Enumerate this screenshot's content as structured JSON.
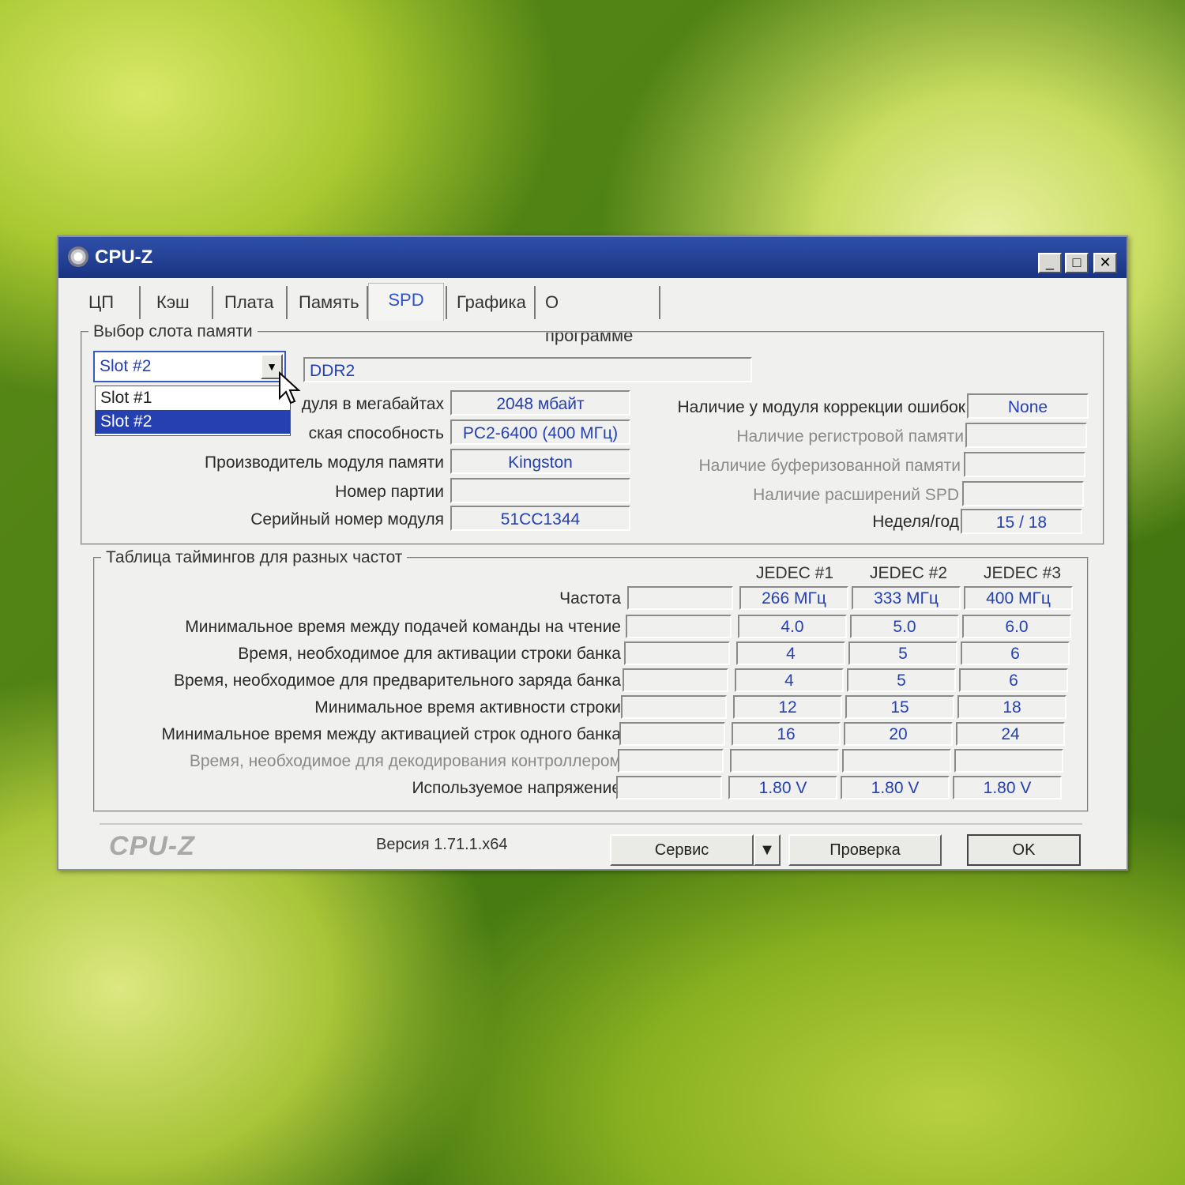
{
  "window": {
    "title": "CPU-Z",
    "min": "_",
    "max": "□",
    "close": "✕"
  },
  "tabs": [
    "ЦП",
    "Кэш",
    "Плата",
    "Память",
    "SPD",
    "Графика",
    "О программе"
  ],
  "active_tab": "SPD",
  "slot_group": {
    "legend": "Выбор слота памяти",
    "selected": "Slot #2",
    "options": [
      "Slot #1",
      "Slot #2"
    ],
    "type": "DDR2",
    "left_rows": [
      {
        "label": "Размер модуля в мегабайтах",
        "label_visible": "дуля в мегабайтах",
        "value": "2048 мбайт"
      },
      {
        "label": "Максимальная пропускная способность",
        "label_visible": "ская способность",
        "value": "PC2-6400 (400 МГц)"
      },
      {
        "label": "Производитель модуля памяти",
        "value": "Kingston"
      },
      {
        "label": "Номер партии",
        "value": ""
      },
      {
        "label": "Серийный номер модуля",
        "value": "51CC1344"
      }
    ],
    "right_rows": [
      {
        "label": "Наличие у модуля коррекции ошибок",
        "value": "None",
        "dim": false
      },
      {
        "label": "Наличие регистровой памяти",
        "value": "",
        "dim": true
      },
      {
        "label": "Наличие буферизованной памяти",
        "value": "",
        "dim": true
      },
      {
        "label": "Наличие расширений SPD",
        "value": "",
        "dim": true
      },
      {
        "label": "Неделя/год",
        "value": "15 / 18",
        "dim": false
      }
    ]
  },
  "timings": {
    "legend": "Таблица таймингов для разных частот",
    "columns": [
      "JEDEC #1",
      "JEDEC #2",
      "JEDEC #3"
    ],
    "rows": [
      {
        "label": "Частота",
        "values": [
          "",
          "266 МГц",
          "333 МГц",
          "400 МГц"
        ],
        "dim": false
      },
      {
        "label": "Минимальное время между подачей команды на чтение",
        "values": [
          "",
          "4.0",
          "5.0",
          "6.0"
        ],
        "dim": false
      },
      {
        "label": "Время, необходимое для активации строки банка",
        "values": [
          "",
          "4",
          "5",
          "6"
        ],
        "dim": false
      },
      {
        "label": "Время, необходимое для предварительного заряда банка",
        "values": [
          "",
          "4",
          "5",
          "6"
        ],
        "dim": false
      },
      {
        "label": "Минимальное время активности строки",
        "values": [
          "",
          "12",
          "15",
          "18"
        ],
        "dim": false
      },
      {
        "label": "Минимальное время между активацией строк одного банка",
        "values": [
          "",
          "16",
          "20",
          "24"
        ],
        "dim": false
      },
      {
        "label": "Время, необходимое для декодирования контроллером",
        "values": [
          "",
          "",
          "",
          ""
        ],
        "dim": true
      },
      {
        "label": "Используемое напряжение",
        "values": [
          "",
          "1.80 V",
          "1.80 V",
          "1.80 V"
        ],
        "dim": false
      }
    ]
  },
  "footer": {
    "logo": "CPU-Z",
    "version": "Версия 1.71.1.x64",
    "service": "Сервис",
    "validate": "Проверка",
    "ok": "OK"
  },
  "icons": {
    "dropdown": "chevron-down-icon",
    "cursor": "mouse-pointer-icon",
    "app": "cpu-z-app-icon"
  }
}
